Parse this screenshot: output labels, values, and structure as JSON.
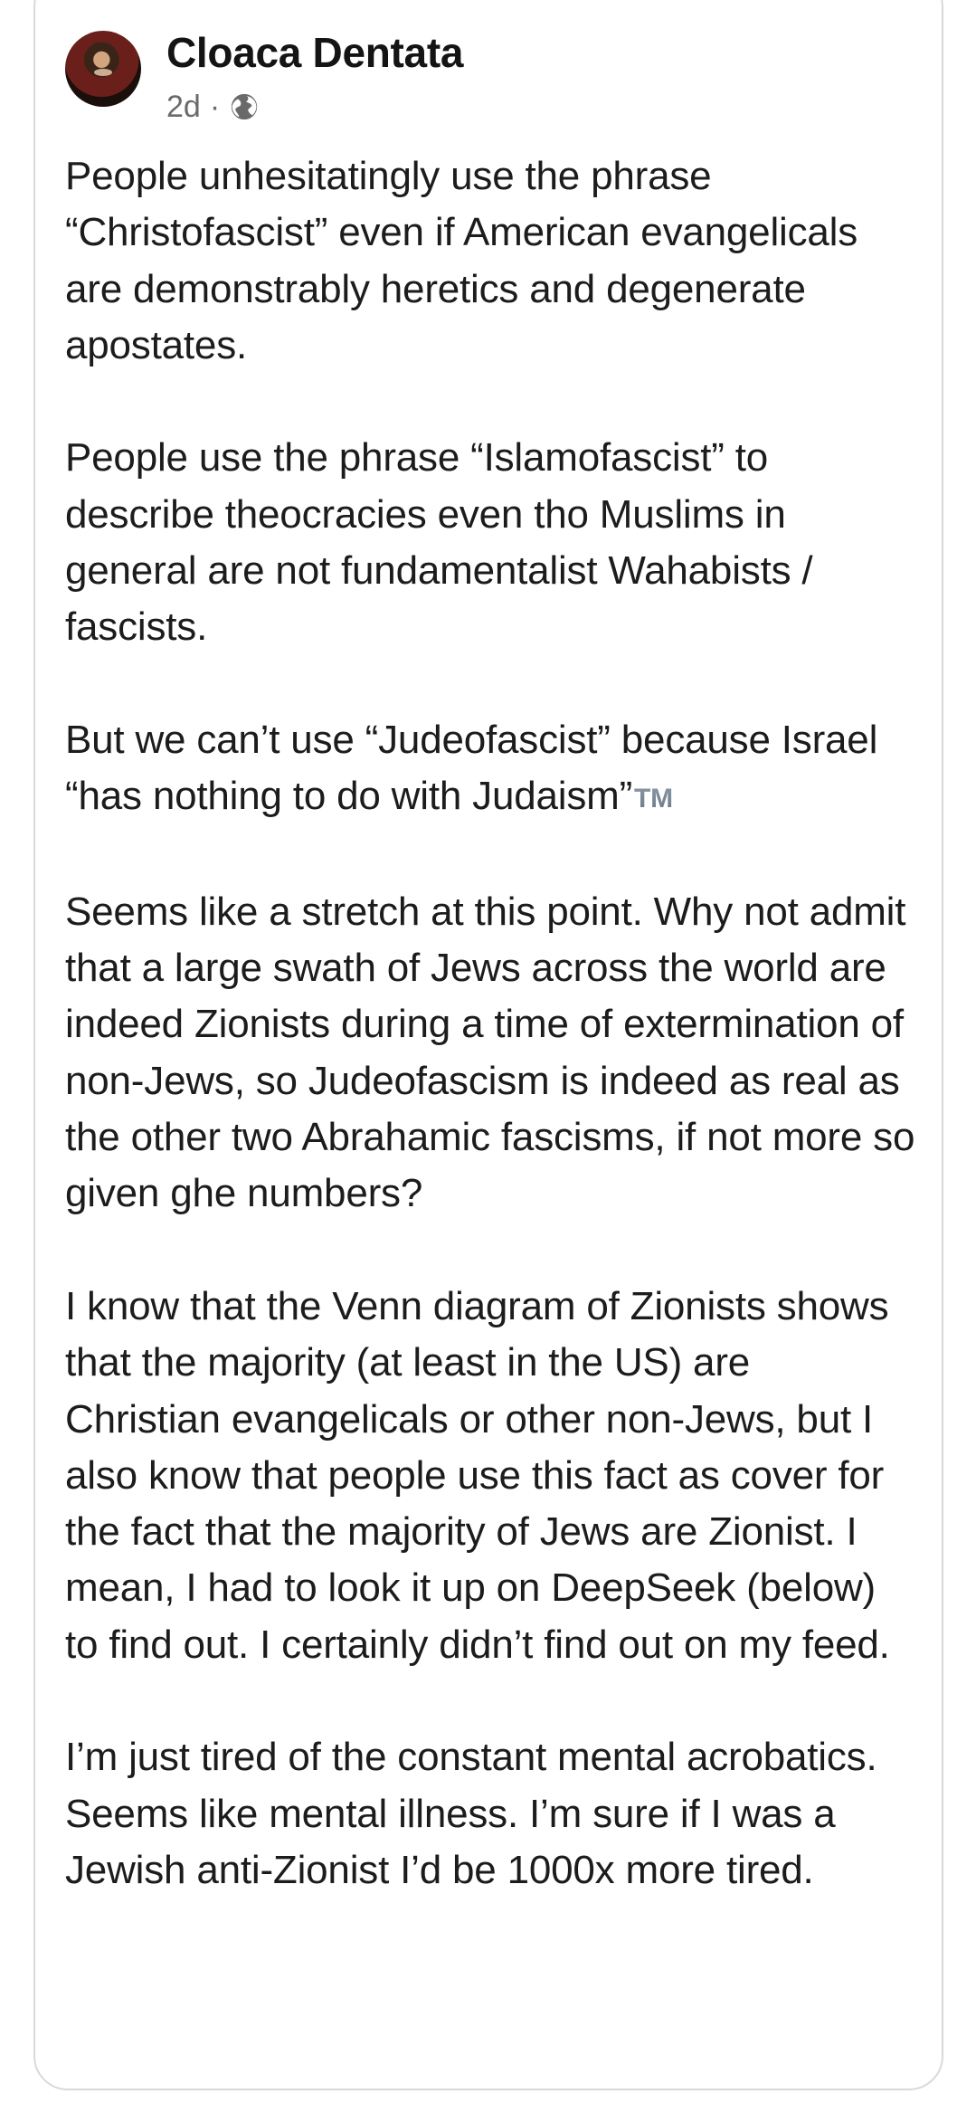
{
  "post": {
    "author": "Cloaca Dentata",
    "time": "2d",
    "separator": "·",
    "privacy_icon": "globe-icon",
    "paragraphs": [
      "People unhesitatingly use the phrase “Christofascist” even if American evangelicals are demonstrably heretics and degenerate apostates.",
      "People use the phrase “Islamofascist” to describe theocracies even tho Muslims in general are not fundamentalist Wahabists / fascists.",
      "But we can’t use “Judeofascist” because Israel “has nothing to do with Judaism”",
      "Seems like a stretch at this point. Why not admit that a large swath of Jews across the world are indeed Zionists during a time of extermination of non-Jews, so Judeofascism is indeed as real as the other two Abrahamic fascisms, if not more so given ghe numbers?",
      "I know that the Venn diagram of Zionists shows that the majority (at least in the US) are Christian evangelicals or other non-Jews, but I also know that people use this fact as cover for the fact that the majority of Jews are Zionist. I mean, I had to look it up on DeepSeek (below) to find out. I certainly didn’t find out on my feed.",
      "I’m just tired of the constant mental acrobatics. Seems like mental illness. I’m sure if I was a Jewish anti-Zionist I’d be 1000x more tired."
    ],
    "tm_symbol": "TM"
  }
}
